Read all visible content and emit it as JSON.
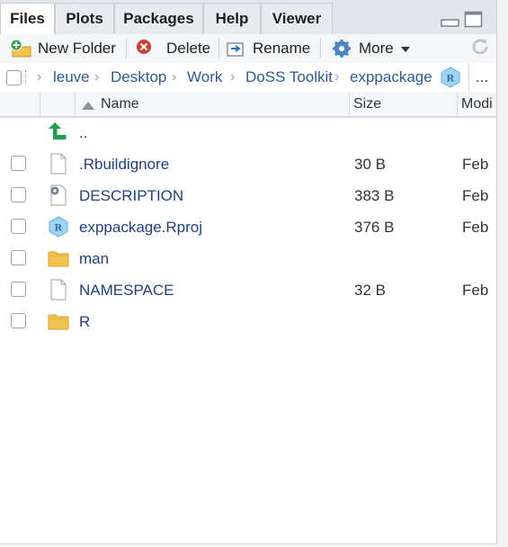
{
  "tabs": [
    {
      "label": "Files",
      "active": true
    },
    {
      "label": "Plots",
      "active": false
    },
    {
      "label": "Packages",
      "active": false
    },
    {
      "label": "Help",
      "active": false
    },
    {
      "label": "Viewer",
      "active": false
    }
  ],
  "toolbar": {
    "new_folder": "New Folder",
    "delete": "Delete",
    "rename": "Rename",
    "more": "More",
    "icons": [
      "new-folder-icon",
      "delete-icon",
      "rename-icon",
      "gear-icon",
      "refresh-icon"
    ]
  },
  "breadcrumb": {
    "items": [
      "leuve",
      "Desktop",
      "Work",
      "DoSS Toolkit",
      "exppackage"
    ],
    "overflow": "..."
  },
  "columns": {
    "name": "Name",
    "size": "Size",
    "modified": "Modi"
  },
  "parent_label": "..",
  "files": [
    {
      "name": ".Rbuildignore",
      "size": "30 B",
      "modified": "Feb",
      "icon": "file-icon"
    },
    {
      "name": "DESCRIPTION",
      "size": "383 B",
      "modified": "Feb",
      "icon": "description-file-icon"
    },
    {
      "name": "exppackage.Rproj",
      "size": "376 B",
      "modified": "Feb",
      "icon": "rproj-icon"
    },
    {
      "name": "man",
      "size": "",
      "modified": "",
      "icon": "folder-icon"
    },
    {
      "name": "NAMESPACE",
      "size": "32 B",
      "modified": "Feb",
      "icon": "file-icon"
    },
    {
      "name": "R",
      "size": "",
      "modified": "",
      "icon": "folder-icon"
    }
  ],
  "colors": {
    "link": "#2a5a9a",
    "filename": "#1f3f8a",
    "folder": "#f2c14e",
    "up_arrow": "#1aa34a"
  }
}
